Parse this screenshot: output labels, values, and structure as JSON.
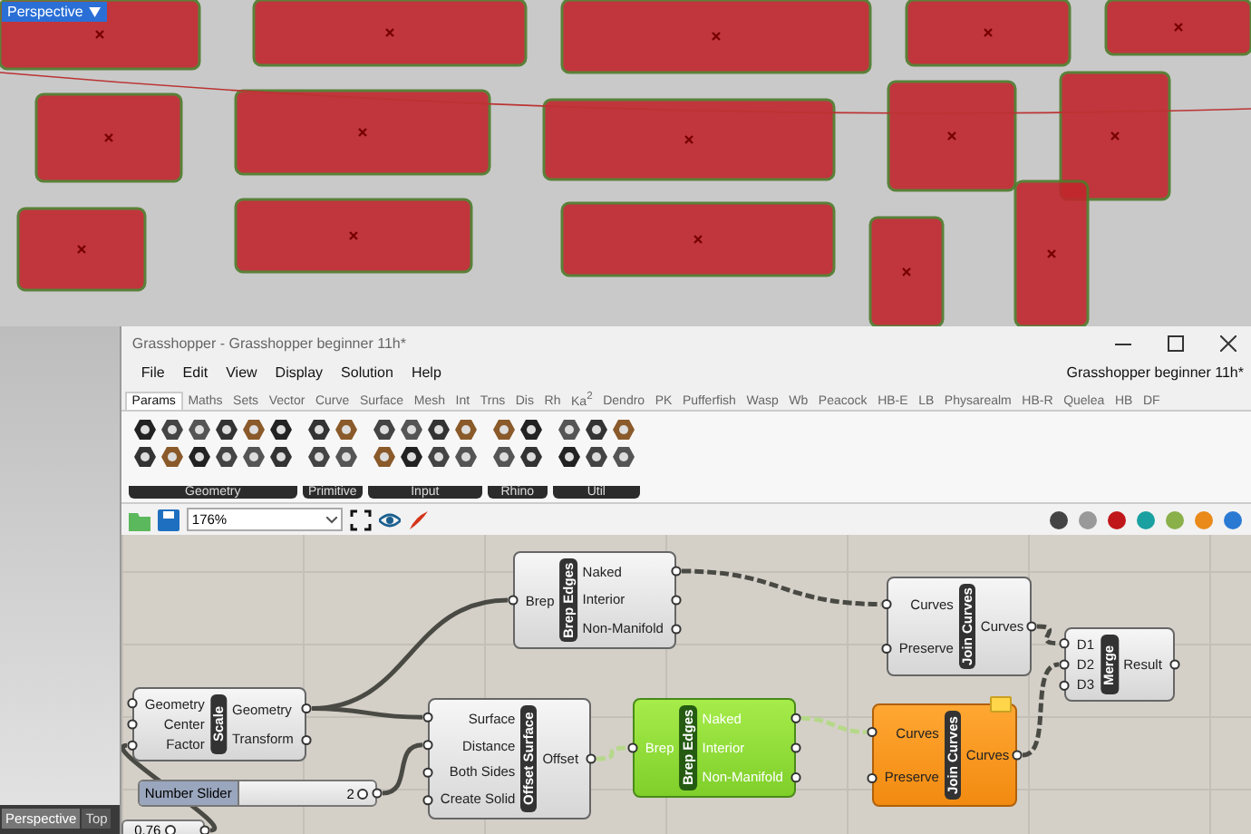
{
  "viewport": {
    "label": "Perspective",
    "tabs": [
      {
        "label": "Perspective",
        "selected": true
      },
      {
        "label": "Top",
        "selected": false
      }
    ]
  },
  "window": {
    "title": "Grasshopper - Grasshopper beginner 11h*"
  },
  "menu": [
    "File",
    "Edit",
    "View",
    "Display",
    "Solution",
    "Help"
  ],
  "document_title": "Grasshopper beginner 11h*",
  "tabs": [
    {
      "label": "Params",
      "selected": true
    },
    {
      "label": "Maths",
      "selected": false
    },
    {
      "label": "Sets",
      "selected": false
    },
    {
      "label": "Vector",
      "selected": false
    },
    {
      "label": "Curve",
      "selected": false
    },
    {
      "label": "Surface",
      "selected": false
    },
    {
      "label": "Mesh",
      "selected": false
    },
    {
      "label": "Int",
      "selected": false
    },
    {
      "label": "Trns",
      "selected": false
    },
    {
      "label": "Dis",
      "selected": false
    },
    {
      "label": "Rh",
      "selected": false
    },
    {
      "label": "Ka$^{2}$",
      "selected": false
    },
    {
      "label": "Dendro",
      "selected": false
    },
    {
      "label": "PK",
      "selected": false
    },
    {
      "label": "Pufferfish",
      "selected": false
    },
    {
      "label": "Wasp",
      "selected": false
    },
    {
      "label": "Wb",
      "selected": false
    },
    {
      "label": "Peacock",
      "selected": false
    },
    {
      "label": "HB-E",
      "selected": false
    },
    {
      "label": "LB",
      "selected": false
    },
    {
      "label": "Physarealm",
      "selected": false
    },
    {
      "label": "HB-R",
      "selected": false
    },
    {
      "label": "Quelea",
      "selected": false
    },
    {
      "label": "HB",
      "selected": false
    },
    {
      "label": "DF",
      "selected": false
    }
  ],
  "ribbon_groups": [
    "Geometry",
    "Primitive",
    "Input",
    "Rhino",
    "Util"
  ],
  "zoom": {
    "value": "176%"
  },
  "nodes": [
    {
      "kind": "component",
      "name": "Brep Edges",
      "inputs": [
        "Brep"
      ],
      "outputs": [
        "Naked",
        "Interior",
        "Non-Manifold"
      ],
      "selected": false,
      "warning": false
    },
    {
      "kind": "component",
      "name": "Join Curves",
      "inputs": [
        "Curves",
        "Preserve"
      ],
      "outputs": [
        "Curves"
      ],
      "selected": false,
      "warning": false
    },
    {
      "kind": "component",
      "name": "Merge",
      "inputs": [
        "D1",
        "D2",
        "D3"
      ],
      "outputs": [
        "Result"
      ],
      "selected": false,
      "warning": false
    },
    {
      "kind": "component",
      "name": "Scale",
      "inputs": [
        "Geometry",
        "Center",
        "Factor"
      ],
      "outputs": [
        "Geometry",
        "Transform"
      ],
      "selected": false,
      "warning": false
    },
    {
      "kind": "component",
      "name": "Offset Surface",
      "inputs": [
        "Surface",
        "Distance",
        "Both Sides",
        "Create Solid"
      ],
      "outputs": [
        "Offset"
      ],
      "selected": false,
      "warning": false
    },
    {
      "kind": "component",
      "name": "Brep Edges",
      "inputs": [
        "Brep"
      ],
      "outputs": [
        "Naked",
        "Interior",
        "Non-Manifold"
      ],
      "selected": true,
      "warning": false
    },
    {
      "kind": "component",
      "name": "Join Curves",
      "inputs": [
        "Curves",
        "Preserve"
      ],
      "outputs": [
        "Curves"
      ],
      "selected": false,
      "warning": true
    },
    {
      "kind": "slider",
      "name": "Number Slider",
      "value": "2",
      "level": 0.95
    },
    {
      "kind": "slider",
      "value": "0.76",
      "level": 0.6
    }
  ]
}
